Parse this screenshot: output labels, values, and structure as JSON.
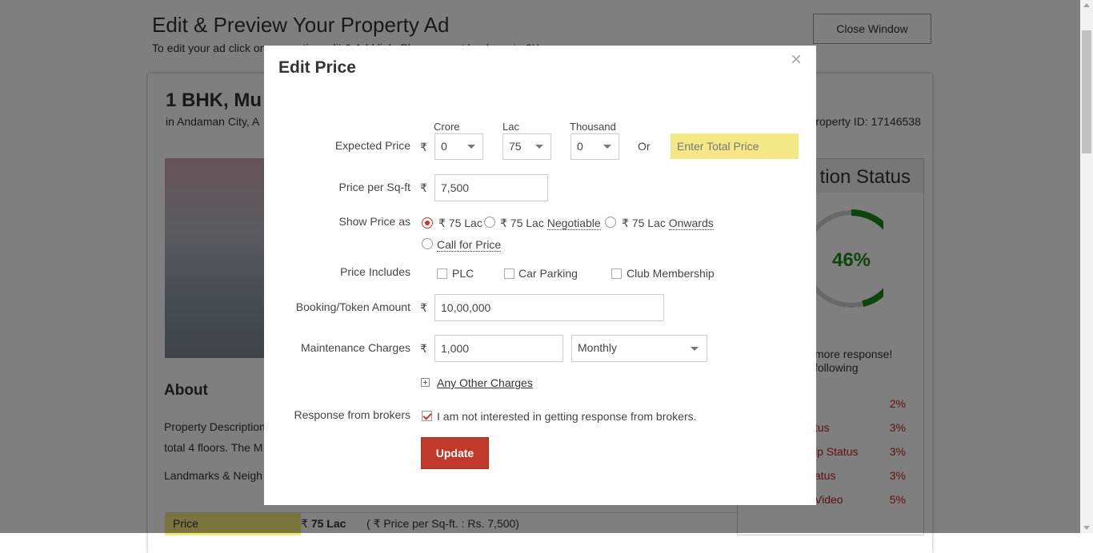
{
  "page": {
    "title": "Edit & Preview Your Property Ad",
    "subtitle": "To edit your ad click on respective edit & Add link. Please… get leads up to 3X …",
    "close_window": "Close Window",
    "property_heading": "1 BHK, Mu",
    "property_location": "in Andaman City, A",
    "property_id": "Property ID: 17146538",
    "about_heading": "About",
    "about_line1": "Property Description",
    "about_line2": "total 4 floors. The M",
    "landmarks": "Landmarks & Neigh",
    "price_label": "Price",
    "price_value": "75 Lac",
    "price_rupee": "₹",
    "price_per_sqft": "( ₹ Price per Sq-ft. : Rs. 7,500)"
  },
  "status_panel": {
    "heading": "tion Status",
    "percent": "46%",
    "percent_value": 0.46,
    "message_line1": "more response!",
    "message_line2": "following",
    "items": [
      {
        "label": "",
        "pct": "2%"
      },
      {
        "label": "tus",
        "pct": "3%"
      },
      {
        "label": "ip Status",
        "pct": "3%"
      },
      {
        "label": "atus",
        "pct": "3%"
      },
      {
        "label": "Video",
        "pct": "5%"
      }
    ],
    "colors": {
      "ring": "#1a8a1a",
      "ring_bg": "#d0d0d0",
      "link": "#b22222"
    }
  },
  "modal": {
    "title": "Edit Price",
    "close": "×",
    "rupee": "₹",
    "expected_price": {
      "label": "Expected Price",
      "crore_label": "Crore",
      "crore_value": "0",
      "lac_label": "Lac",
      "lac_value": "75",
      "thousand_label": "Thousand",
      "thousand_value": "0",
      "or": "Or",
      "total_placeholder": "Enter Total Price"
    },
    "price_per_sqft": {
      "label": "Price per Sq-ft",
      "value": "7,500"
    },
    "show_price_as": {
      "label": "Show Price as",
      "options": [
        {
          "prefix": "₹ 75 Lac",
          "suffix": "",
          "selected": true
        },
        {
          "prefix": "₹ 75 Lac",
          "suffix": "Negotiable",
          "selected": false
        },
        {
          "prefix": "₹ 75 Lac",
          "suffix": "Onwards",
          "selected": false
        },
        {
          "prefix": "",
          "suffix": "Call for Price",
          "selected": false
        }
      ]
    },
    "price_includes": {
      "label": "Price Includes",
      "options": [
        "PLC",
        "Car Parking",
        "Club Membership"
      ]
    },
    "booking": {
      "label": "Booking/Token Amount",
      "value": "10,00,000"
    },
    "maintenance": {
      "label": "Maintenance Charges",
      "value": "1,000",
      "period": "Monthly"
    },
    "other_charges": "Any Other Charges",
    "brokers": {
      "label": "Response from brokers",
      "text": "I am not interested in getting response from brokers.",
      "checked": true
    },
    "update": "Update",
    "colors": {
      "accent": "#c0392b",
      "highlight": "#f4e886"
    }
  }
}
